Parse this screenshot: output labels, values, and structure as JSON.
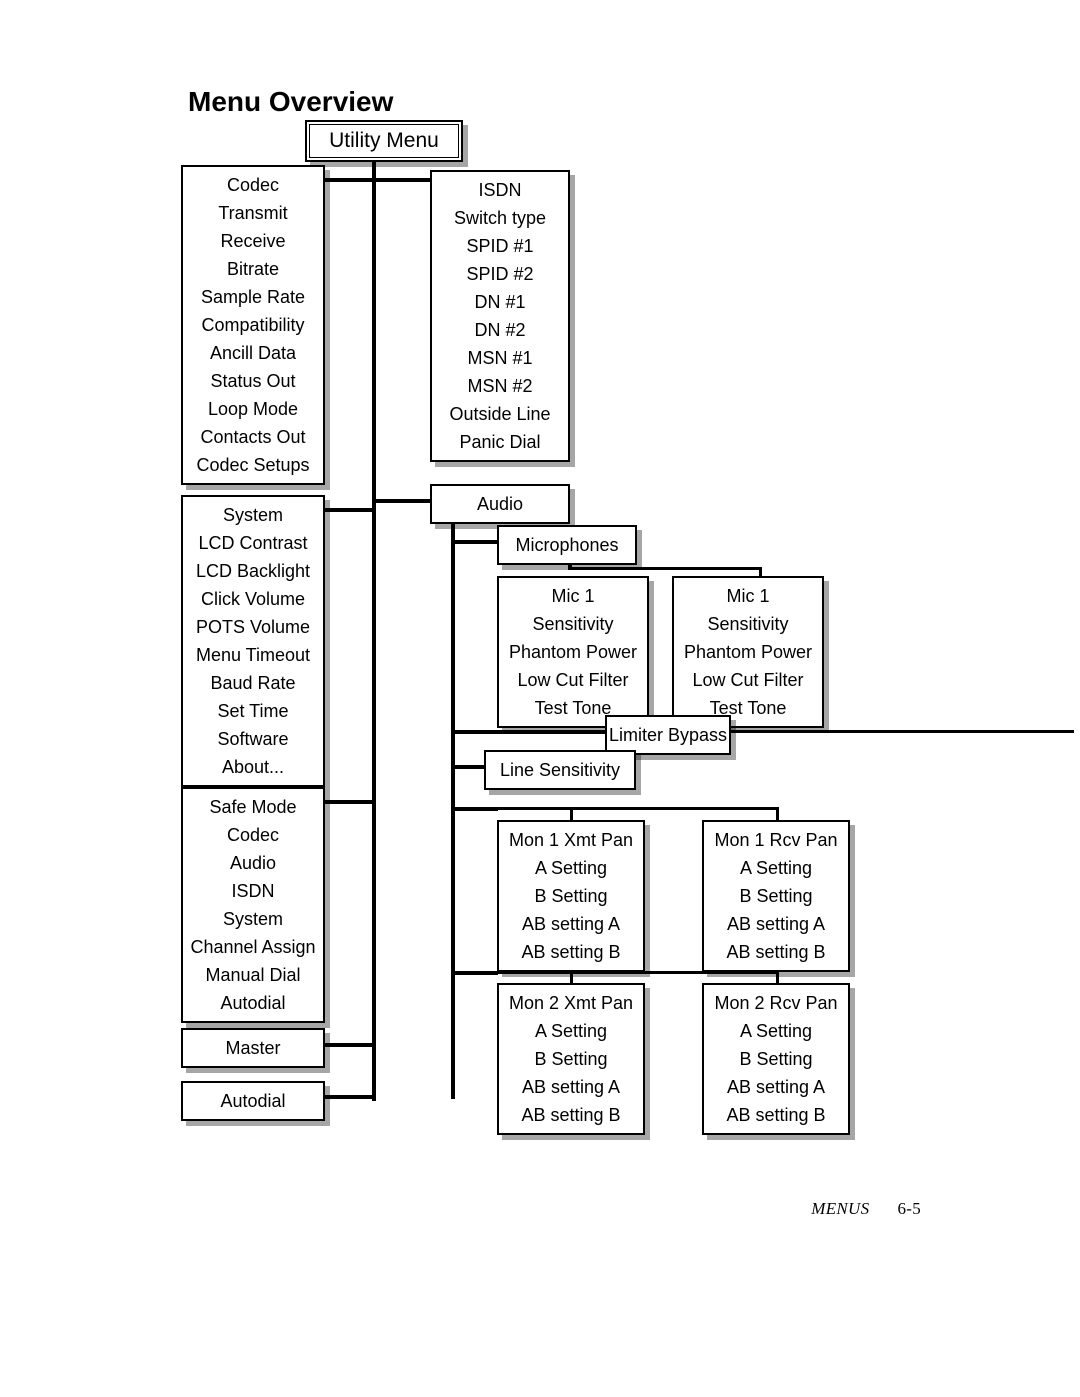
{
  "heading": "Menu Overview",
  "footer_label": "MENUS",
  "footer_page": "6-5",
  "utility_menu": "Utility Menu",
  "codec": [
    "Codec",
    "Transmit",
    "Receive",
    "Bitrate",
    "Sample Rate",
    "Compatibility",
    "Ancill Data",
    "Status Out",
    "Loop Mode",
    "Contacts Out",
    "Codec Setups"
  ],
  "system": [
    "System",
    "LCD Contrast",
    "LCD Backlight",
    "Click Volume",
    "POTS Volume",
    "Menu Timeout",
    "Baud Rate",
    "Set Time",
    "Software",
    "About..."
  ],
  "safe": [
    "Safe Mode",
    "Codec",
    "Audio",
    "ISDN",
    "System",
    "Channel Assign",
    "Manual Dial",
    "Autodial"
  ],
  "master": "Master",
  "autodial": "Autodial",
  "isdn": [
    "ISDN",
    "Switch type",
    "SPID #1",
    "SPID #2",
    "DN #1",
    "DN #2",
    "MSN #1",
    "MSN #2",
    "Outside Line",
    "Panic Dial"
  ],
  "audio": "Audio",
  "microphones": "Microphones",
  "mic1": [
    "Mic 1",
    "Sensitivity",
    "Phantom Power",
    "Low Cut Filter",
    "Test Tone"
  ],
  "mic2": [
    "Mic 1",
    "Sensitivity",
    "Phantom Power",
    "Low Cut Filter",
    "Test Tone"
  ],
  "limiter": "Limiter Bypass",
  "line_sensitivity": "Line Sensitivity",
  "mon1xmt": [
    "Mon 1 Xmt Pan",
    "A Setting",
    "B Setting",
    "AB setting A",
    "AB setting B"
  ],
  "mon1rcv": [
    "Mon 1 Rcv Pan",
    "A Setting",
    "B Setting",
    "AB setting A",
    "AB setting B"
  ],
  "mon2xmt": [
    "Mon 2 Xmt Pan",
    "A Setting",
    "B Setting",
    "AB setting A",
    "AB setting B"
  ],
  "mon2rcv": [
    "Mon 2 Rcv Pan",
    "A Setting",
    "B Setting",
    "AB setting A",
    "AB setting B"
  ]
}
